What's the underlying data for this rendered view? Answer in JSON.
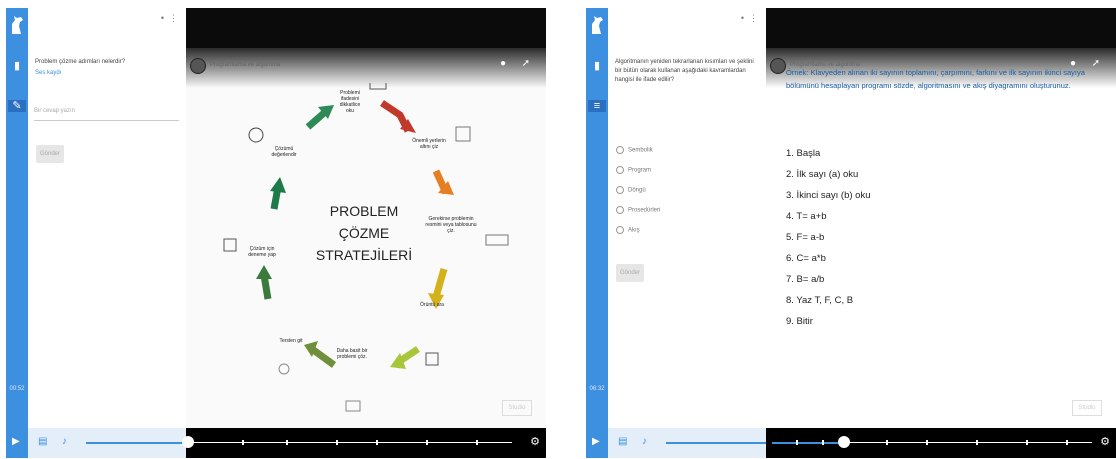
{
  "left": {
    "sidebar": {
      "question": "Problem çözme adımları nelerdir?",
      "link": "Ses kaydı",
      "input_placeholder": "Bir cevap yazın",
      "button": "Gönder"
    },
    "rail_time": "00:52",
    "video": {
      "channel": "Programlama ve algoritma",
      "center_lines": [
        "PROBLEM",
        "ÇÖZME",
        "STRATEJİLERİ"
      ],
      "steps": [
        "Problemi ifadesini dikkatlice oku",
        "Önemli yerlerin altını çiz",
        "Gerekirse problemin resmini veya tablosunu çiz.",
        "Örüntü ara",
        "Daha basit bir problemi çöz.",
        "Tersten git",
        "Çözüm için deneme yap",
        "Çözümü değerlendir"
      ],
      "watermark": "Studio",
      "colors": {
        "red": "#c0392b",
        "orange": "#e67e22",
        "yellow": "#d4b21c",
        "lime": "#a8c63a",
        "olive": "#6f8f3a",
        "green": "#2e8b57",
        "teal": "#1fa07a"
      }
    }
  },
  "right": {
    "sidebar": {
      "question": "Algoritmanın yeniden tekrarlanan kısımları ve şeklini bir bütün olarak kullanan aşağıdaki kavramlardan hangisi ile ifade edilir?",
      "options": [
        "Sembolik",
        "Program",
        "Döngü",
        "Prosedürleri",
        "Akış"
      ],
      "button": "Gönder"
    },
    "rail_time": "06:32",
    "video": {
      "channel": "Programlama ve algoritma",
      "example_text": "Örnek: Klavyeden alınan iki sayının toplamını, çarpımını, farkını ve ilk sayının ikinci sayıya bölümünü hesaplayan programı sözde, algoritmasını ve akış diyagramını oluşturunuz.",
      "steps": [
        "1. Başla",
        "2. İlk sayı (a) oku",
        "3. İkinci sayı (b) oku",
        "4. T= a+b",
        "5. F= a-b",
        "6. C= a*b",
        "7. B= a/b",
        "8. Yaz T, F, C, B",
        "9. Bitir"
      ],
      "watermark": "Studio"
    }
  }
}
